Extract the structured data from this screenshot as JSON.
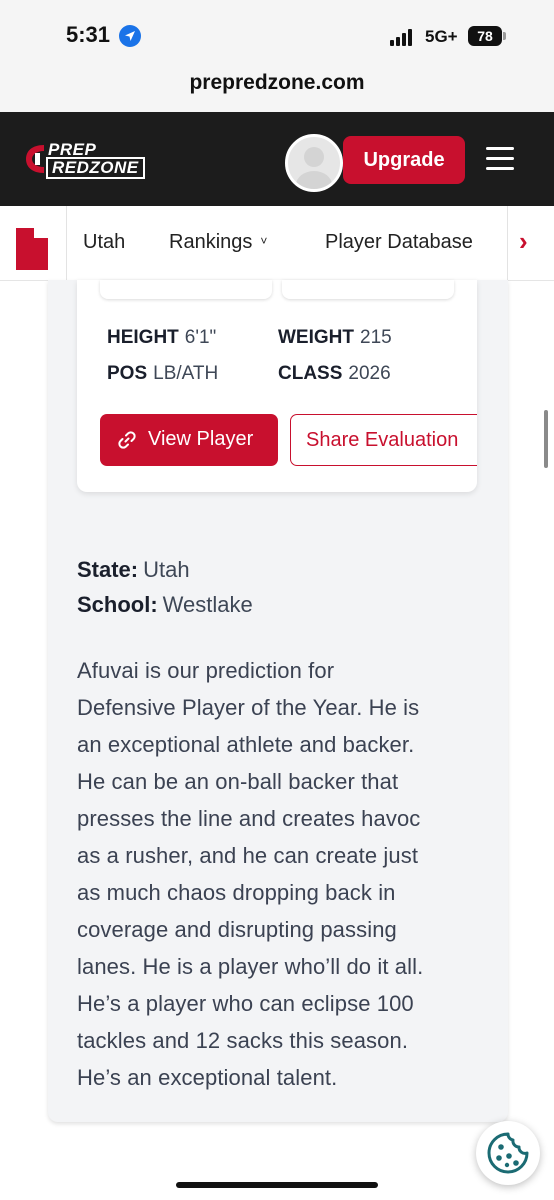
{
  "status_bar": {
    "time": "5:31",
    "network": "5G+",
    "battery": "78"
  },
  "browser": {
    "url": "prepredzone.com"
  },
  "header": {
    "logo_line1": "PREP",
    "logo_line2": "REDZONE",
    "upgrade_label": "Upgrade",
    "accent_color": "#c8102e"
  },
  "subnav": {
    "items": [
      {
        "label": "Utah"
      },
      {
        "label": "Rankings"
      },
      {
        "label": "Player Database"
      }
    ]
  },
  "player": {
    "stats": [
      {
        "label": "HEIGHT",
        "value": "6'1\""
      },
      {
        "label": "WEIGHT",
        "value": "215"
      },
      {
        "label": "POS",
        "value": "LB/ATH"
      },
      {
        "label": "CLASS",
        "value": "2026"
      }
    ],
    "view_label": "View Player",
    "share_label": "Share Evaluation"
  },
  "article": {
    "state_label": "State:",
    "state_value": "Utah",
    "school_label": "School:",
    "school_value": "Westlake",
    "body_lines": [
      "Afuvai is our prediction for",
      "Defensive Player of the Year. He is",
      "an exceptional athlete and backer.",
      "He can be an on-ball backer that",
      "presses the line and creates havoc",
      "as a rusher, and he can create just",
      "as much chaos dropping back in",
      "coverage and disrupting passing",
      "lanes. He is a player who’ll do it all.",
      "He’s a player who can eclipse 100",
      "tackles and 12 sacks this season.",
      "He’s an exceptional talent."
    ]
  }
}
